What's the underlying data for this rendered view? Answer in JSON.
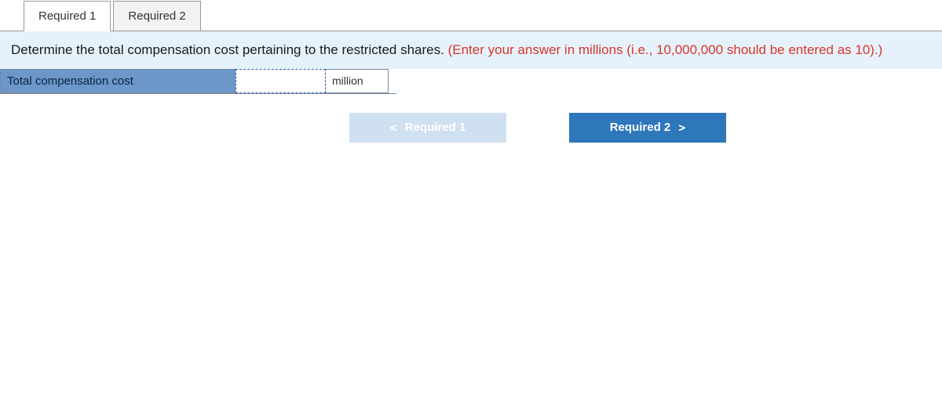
{
  "tabs": [
    {
      "label": "Required 1",
      "active": true
    },
    {
      "label": "Required 2",
      "active": false
    }
  ],
  "instructions": {
    "main": "Determine the total compensation cost pertaining to the restricted shares.",
    "hint": "(Enter your answer in millions (i.e., 10,000,000 should be entered as 10).)"
  },
  "answer": {
    "label": "Total compensation cost",
    "value": "",
    "unit": "million"
  },
  "nav": {
    "prev": "Required 1",
    "next": "Required 2"
  }
}
